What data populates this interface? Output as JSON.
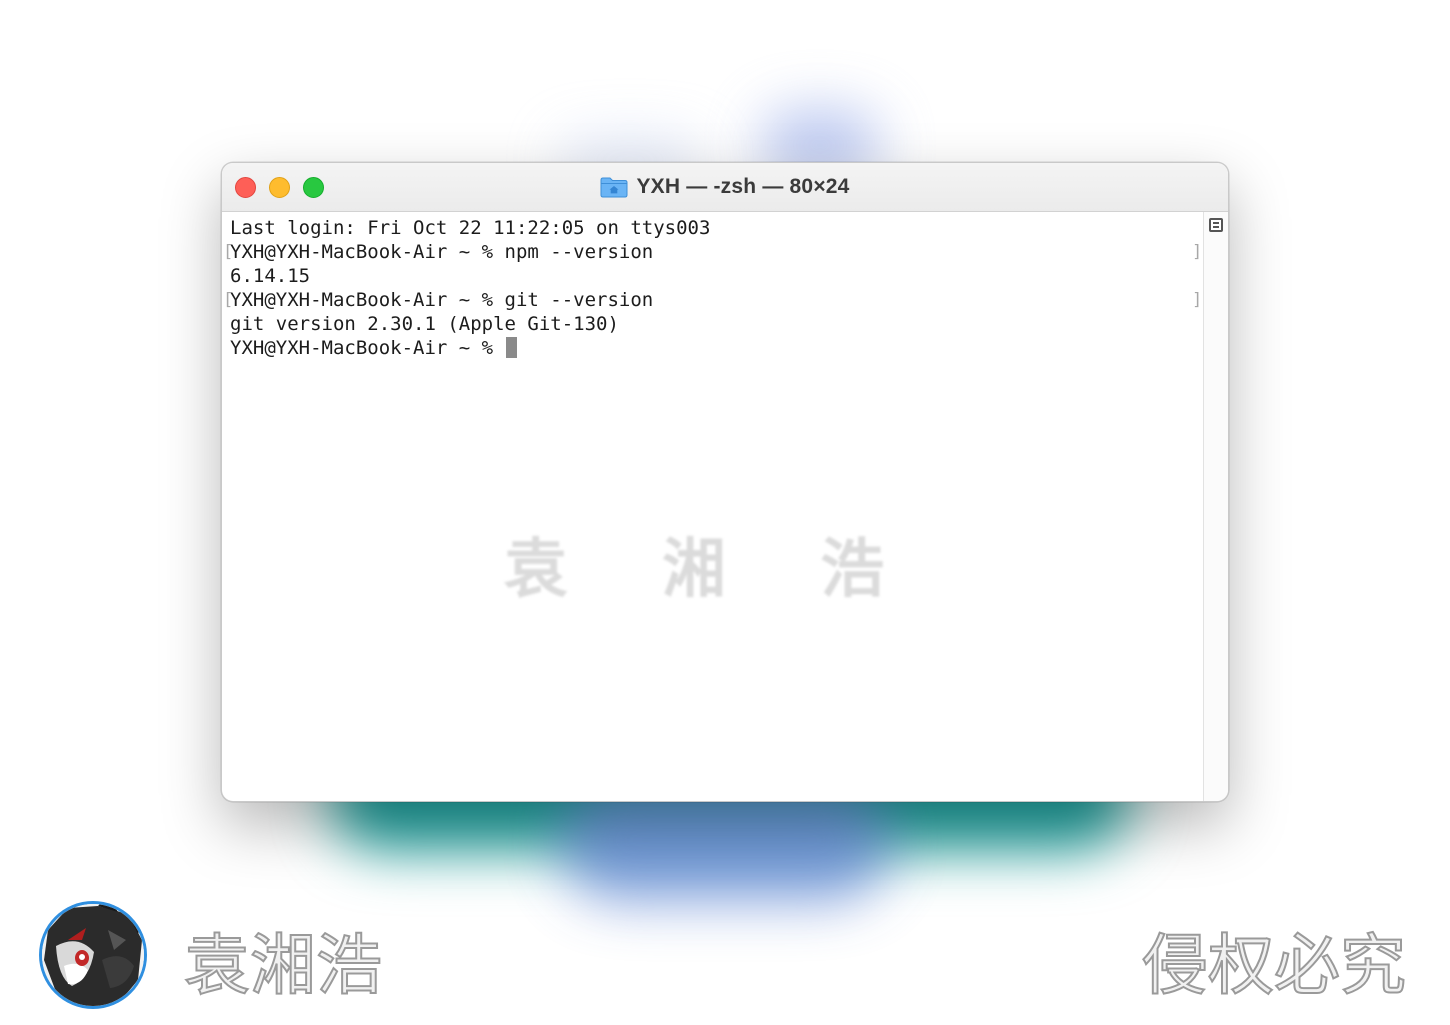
{
  "window": {
    "title": "YXH — -zsh — 80×24",
    "title_icon": "home-folder-icon"
  },
  "terminal": {
    "lines": [
      "Last login: Fri Oct 22 11:22:05 on ttys003",
      "YXH@YXH-MacBook-Air ~ % npm --version",
      "6.14.15",
      "YXH@YXH-MacBook-Air ~ % git --version",
      "git version 2.30.1 (Apple Git-130)",
      "YXH@YXH-MacBook-Air ~ % "
    ]
  },
  "watermark": {
    "center": "袁 湘 浩",
    "author": "袁湘浩",
    "copyright": "侵权必究"
  },
  "colors": {
    "close": "#fe5f57",
    "minimize": "#febc2e",
    "maximize": "#28c840",
    "folder": "#5aa8f0"
  }
}
